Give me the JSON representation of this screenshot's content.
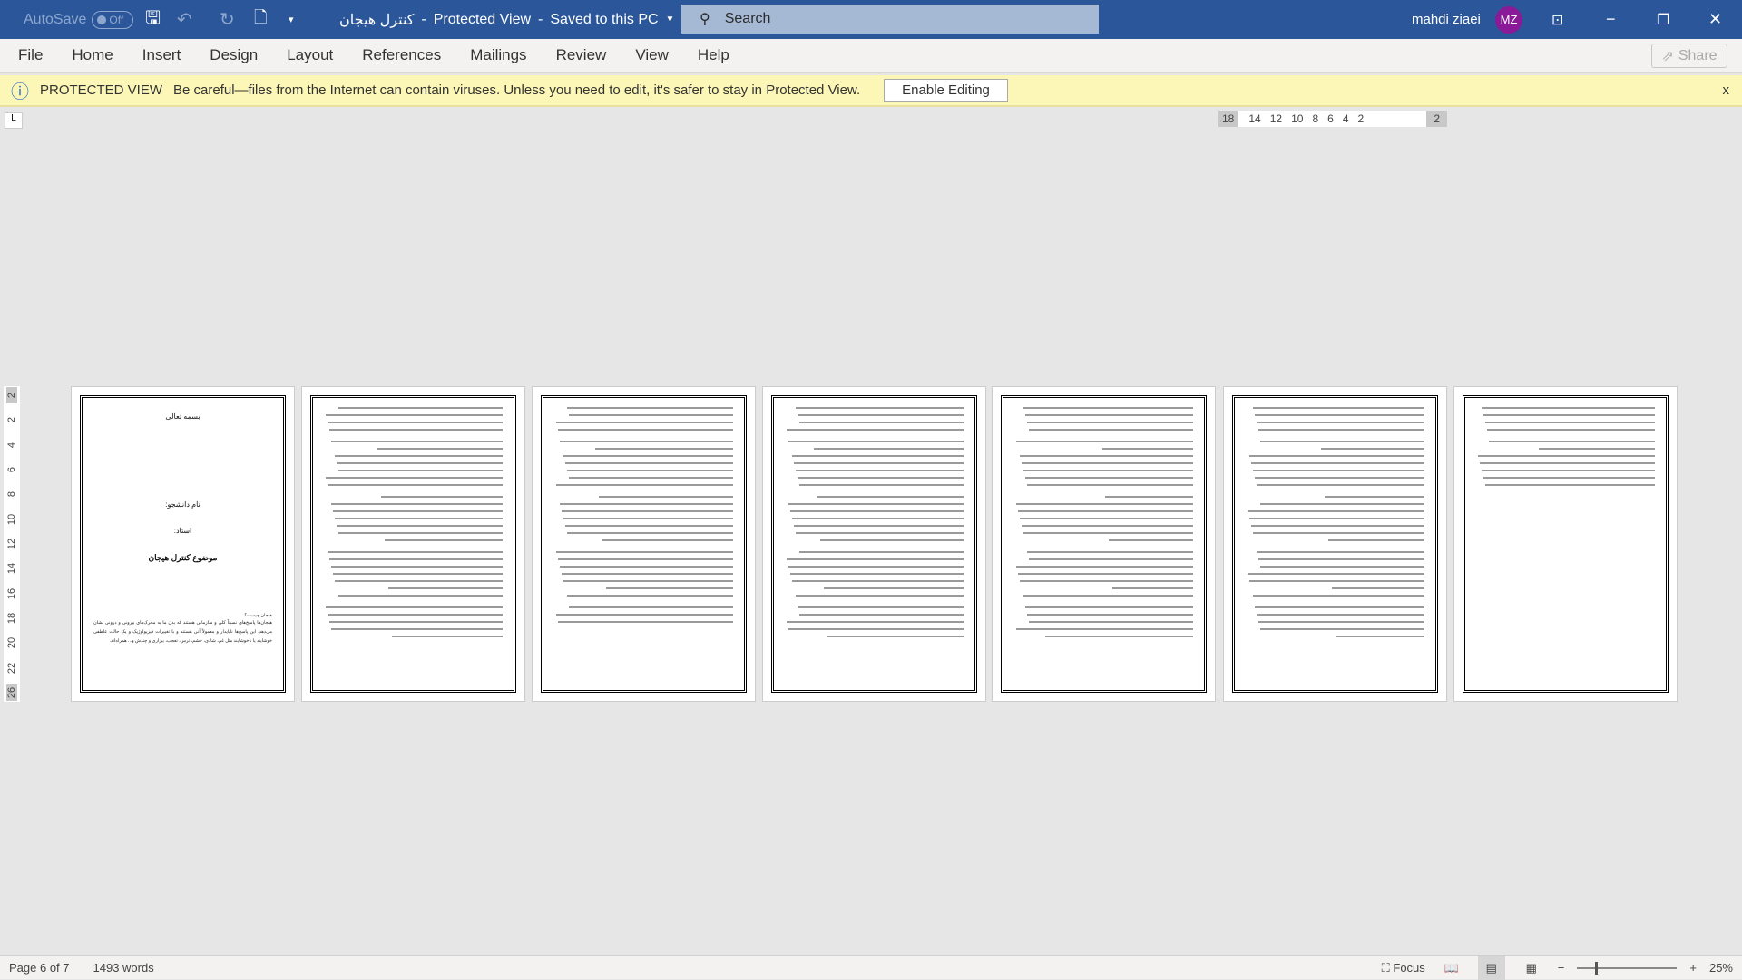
{
  "titlebar": {
    "autosave_label": "AutoSave",
    "autosave_state": "Off",
    "doc_name": "کنترل هیجان",
    "mode": "Protected View",
    "save_state": "Saved to this PC",
    "search_placeholder": "Search",
    "user_name": "mahdi ziaei",
    "user_initials": "MZ",
    "avatar_color": "#8b1a98",
    "brand_color": "#2b579a"
  },
  "menu": {
    "tabs": [
      "File",
      "Home",
      "Insert",
      "Design",
      "Layout",
      "References",
      "Mailings",
      "Review",
      "View",
      "Help"
    ],
    "share": "Share"
  },
  "protected_view": {
    "title": "PROTECTED VIEW",
    "message": "Be careful—files from the Internet can contain viruses. Unless you need to edit, it's safer to stay in Protected View.",
    "button": "Enable Editing",
    "close": "x"
  },
  "ruler": {
    "horizontal": [
      "18",
      "14",
      "12",
      "10",
      "8",
      "6",
      "4",
      "2",
      "2"
    ],
    "vertical": [
      "2",
      "2",
      "4",
      "6",
      "8",
      "10",
      "12",
      "14",
      "16",
      "18",
      "20",
      "22",
      "26"
    ]
  },
  "pages": {
    "first": {
      "line1": "بسمه تعالی",
      "student": "نام دانشجو:",
      "professor": "استاد:",
      "topic": "موضوع کنترل هیجان",
      "question": "هیجان چیست؟",
      "body": "هیجان‌ها پاسخ‌های نسبتاً کلی و سازمانی هستند که بدن ما به محرک‌های بیرونی و درونی نشان می‌دهد. این پاسخ‌ها ناپایدار و معمولاً آنی هستند و با تغییرات فیزیولوژیک و یک حالت عاطفی خوشایند یا ناخوشایند مثل غم، شادی، خشم، ترس، تعجب، بیزاری و چندش و... همراه‌اند."
    }
  },
  "status": {
    "page": "Page 6 of 7",
    "words": "1493 words",
    "focus": "Focus",
    "zoom": "25%",
    "zoom_percent": 25
  }
}
